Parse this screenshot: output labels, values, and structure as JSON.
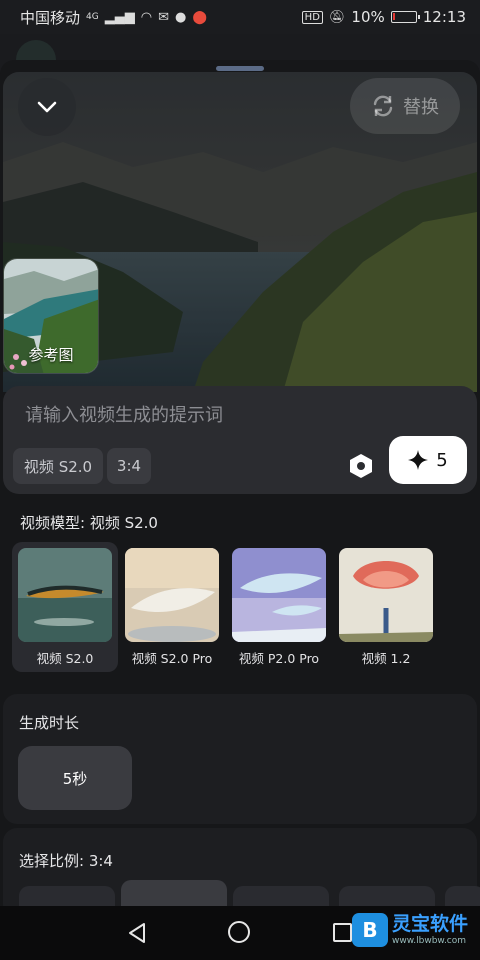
{
  "status_bar": {
    "carrier": "中国移动",
    "network": "4G",
    "battery_percent": "10%",
    "battery_level": 0.1,
    "time": "12:13",
    "hd_badge": "HD"
  },
  "sheet": {
    "collapse_icon": "chevron-down-icon",
    "replace_label": "替换",
    "reference_label": "参考图"
  },
  "prompt": {
    "placeholder": "请输入视频生成的提示词",
    "value": "",
    "model_chip": "视频 S2.0",
    "ratio_chip": "3:4",
    "generate_cost": "5"
  },
  "model_section": {
    "title": "视频模型: 视频 S2.0",
    "models": [
      {
        "label": "视频 S2.0",
        "selected": true
      },
      {
        "label": "视频 S2.0 Pro",
        "selected": false
      },
      {
        "label": "视频 P2.0 Pro",
        "selected": false
      },
      {
        "label": "视频 1.2",
        "selected": false
      }
    ]
  },
  "duration_section": {
    "title": "生成时长",
    "option": "5秒"
  },
  "ratio_section": {
    "title": "选择比例: 3:4"
  },
  "watermark": {
    "badge": "B",
    "title": "灵宝软件",
    "url": "www.lbwbw.com"
  },
  "colors": {
    "accent_white": "#ffffff",
    "panel": "#1d1e21",
    "chip": "#3a3b40",
    "battery_low": "#e53935"
  }
}
